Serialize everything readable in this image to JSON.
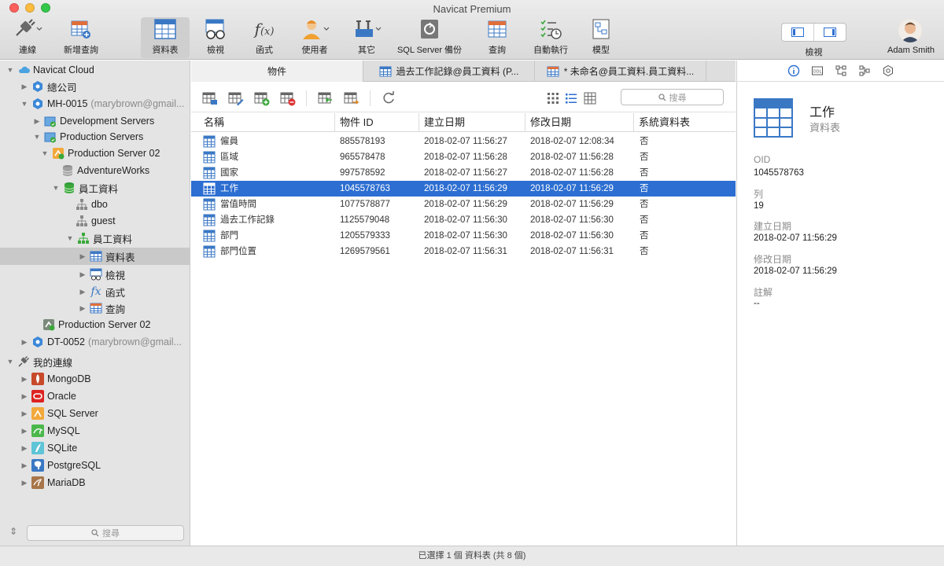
{
  "window": {
    "title": "Navicat Premium"
  },
  "toolbar": {
    "items": [
      {
        "label": "連線",
        "icon": "connection-plug-icon"
      },
      {
        "label": "新增查詢",
        "icon": "new-query-icon"
      },
      {
        "label": "資料表",
        "icon": "table-icon"
      },
      {
        "label": "檢視",
        "icon": "view-glasses-icon"
      },
      {
        "label": "函式",
        "icon": "function-icon"
      },
      {
        "label": "使用者",
        "icon": "user-icon"
      },
      {
        "label": "其它",
        "icon": "tools-icon"
      },
      {
        "label": "SQL Server 備份",
        "icon": "backup-icon"
      },
      {
        "label": "查詢",
        "icon": "query-icon"
      },
      {
        "label": "自動執行",
        "icon": "automation-icon"
      },
      {
        "label": "模型",
        "icon": "model-icon"
      }
    ],
    "view_label": "檢視",
    "user_name": "Adam Smith"
  },
  "sidebar": {
    "tree": [
      {
        "label": "Navicat Cloud",
        "icon": "cloud-icon"
      },
      {
        "label": "總公司",
        "icon": "cloud-project-icon"
      },
      {
        "label": "MH-0015",
        "sub": "(marybrown@gmail...",
        "icon": "cloud-project-icon"
      },
      {
        "label": "Development Servers",
        "icon": "server-group-icon"
      },
      {
        "label": "Production Servers",
        "icon": "server-group-icon"
      },
      {
        "label": "Production Server 02",
        "icon": "sqlserver-connection-icon"
      },
      {
        "label": "AdventureWorks",
        "icon": "database-icon"
      },
      {
        "label": "員工資料",
        "icon": "database-icon"
      },
      {
        "label": "dbo",
        "icon": "schema-icon"
      },
      {
        "label": "guest",
        "icon": "schema-icon"
      },
      {
        "label": "員工資料",
        "icon": "schema-icon"
      },
      {
        "label": "資料表",
        "icon": "table-icon"
      },
      {
        "label": "檢視",
        "icon": "view-icon"
      },
      {
        "label": "函式",
        "icon": "function-icon"
      },
      {
        "label": "查詢",
        "icon": "query-icon"
      },
      {
        "label": "Production Server 02",
        "icon": "sqlserver-connection-icon"
      },
      {
        "label": "DT-0052",
        "sub": "(marybrown@gmail...",
        "icon": "cloud-project-icon"
      },
      {
        "label": "我的連線",
        "icon": "connection-plug-icon"
      },
      {
        "label": "MongoDB",
        "icon": "mongodb-icon"
      },
      {
        "label": "Oracle",
        "icon": "oracle-icon"
      },
      {
        "label": "SQL Server",
        "icon": "sqlserver-icon"
      },
      {
        "label": "MySQL",
        "icon": "mysql-icon"
      },
      {
        "label": "SQLite",
        "icon": "sqlite-icon"
      },
      {
        "label": "PostgreSQL",
        "icon": "postgresql-icon"
      },
      {
        "label": "MariaDB",
        "icon": "mariadb-icon"
      }
    ],
    "search_placeholder": "搜尋"
  },
  "tabs": [
    {
      "label": "物件"
    },
    {
      "label": "過去工作記錄@員工資料 (P..."
    },
    {
      "label": "* 未命名@員工資料.員工資料..."
    }
  ],
  "objects": {
    "search_placeholder": "搜尋",
    "columns": [
      "名稱",
      "物件 ID",
      "建立日期",
      "修改日期",
      "系統資料表"
    ],
    "rows": [
      {
        "name": "僱員",
        "id": "885578193",
        "created": "2018-02-07 11:56:27",
        "modified": "2018-02-07 12:08:34",
        "system": "否"
      },
      {
        "name": "區域",
        "id": "965578478",
        "created": "2018-02-07 11:56:28",
        "modified": "2018-02-07 11:56:28",
        "system": "否"
      },
      {
        "name": "國家",
        "id": "997578592",
        "created": "2018-02-07 11:56:27",
        "modified": "2018-02-07 11:56:28",
        "system": "否"
      },
      {
        "name": "工作",
        "id": "1045578763",
        "created": "2018-02-07 11:56:29",
        "modified": "2018-02-07 11:56:29",
        "system": "否"
      },
      {
        "name": "當值時間",
        "id": "1077578877",
        "created": "2018-02-07 11:56:29",
        "modified": "2018-02-07 11:56:29",
        "system": "否"
      },
      {
        "name": "過去工作記錄",
        "id": "1125579048",
        "created": "2018-02-07 11:56:30",
        "modified": "2018-02-07 11:56:30",
        "system": "否"
      },
      {
        "name": "部門",
        "id": "1205579333",
        "created": "2018-02-07 11:56:30",
        "modified": "2018-02-07 11:56:30",
        "system": "否"
      },
      {
        "name": "部門位置",
        "id": "1269579561",
        "created": "2018-02-07 11:56:31",
        "modified": "2018-02-07 11:56:31",
        "system": "否"
      }
    ]
  },
  "info": {
    "name": "工作",
    "type": "資料表",
    "fields": [
      {
        "label": "OID",
        "value": "1045578763"
      },
      {
        "label": "列",
        "value": "19"
      },
      {
        "label": "建立日期",
        "value": "2018-02-07 11:56:29"
      },
      {
        "label": "修改日期",
        "value": "2018-02-07 11:56:29"
      },
      {
        "label": "註解",
        "value": "--"
      }
    ]
  },
  "status": {
    "text": "已選擇 1 個 資料表 (共 8 個)"
  },
  "colors": {
    "accent": "#2c6ed1",
    "table_icon": "#3b78c4",
    "green": "#3aa83a"
  }
}
